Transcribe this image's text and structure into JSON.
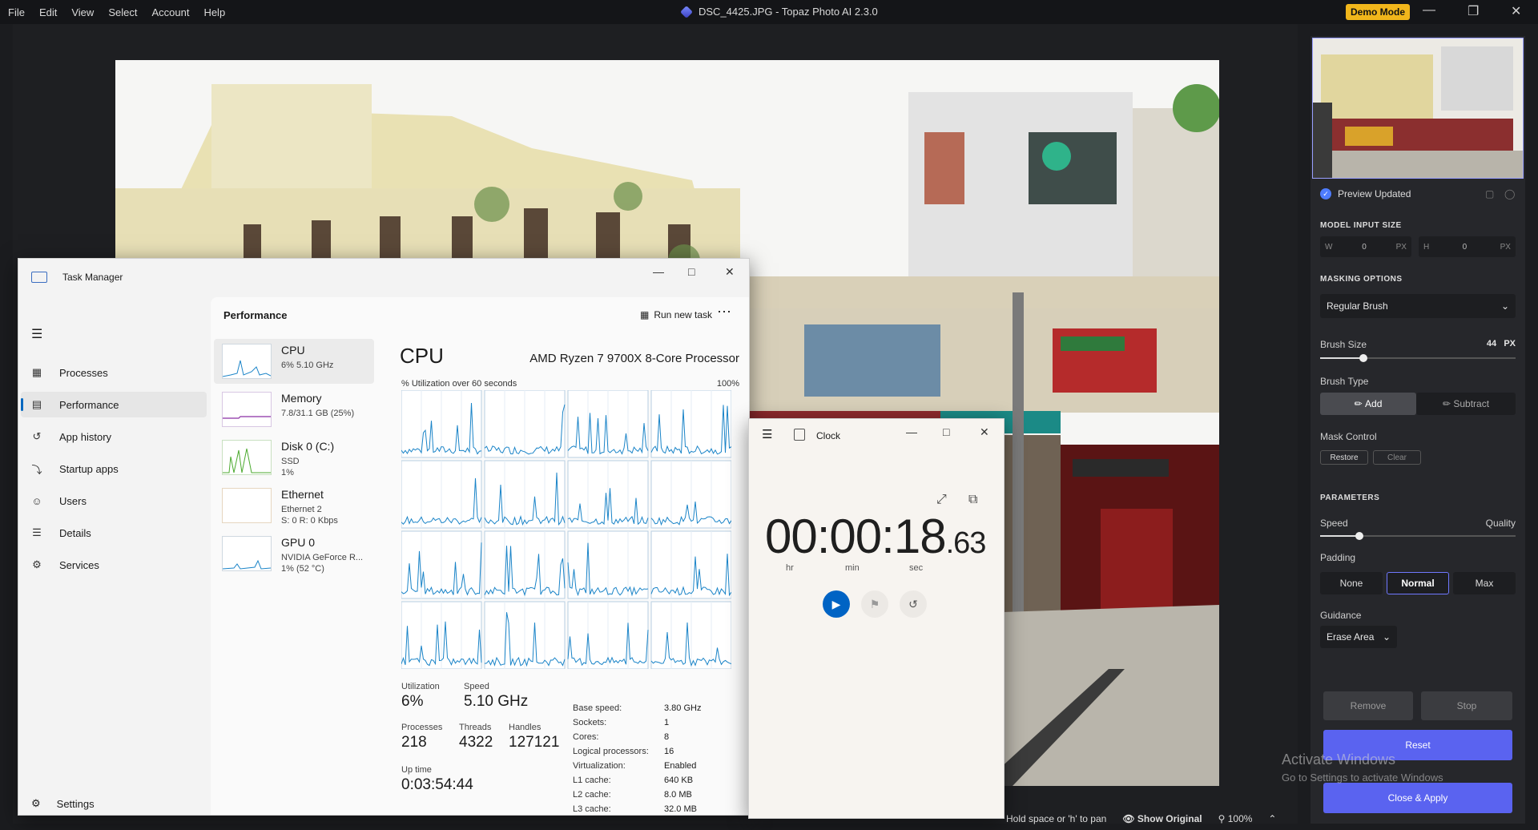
{
  "topaz": {
    "menu": [
      "File",
      "Edit",
      "View",
      "Select",
      "Account",
      "Help"
    ],
    "title": "DSC_4425.JPG - Topaz Photo AI 2.3.0",
    "demo_mode": "Demo Mode",
    "bottom": {
      "hint": "Hold space or 'h' to pan",
      "show_original": "Show Original",
      "zoom": "100%"
    },
    "panel": {
      "preview_status": "Preview Updated",
      "model_input_size": "MODEL INPUT SIZE",
      "w_label": "W",
      "w_value": "0",
      "h_label": "H",
      "h_value": "0",
      "px": "PX",
      "masking_options": "MASKING OPTIONS",
      "brush_dropdown": "Regular Brush",
      "brush_size_label": "Brush Size",
      "brush_size_value": "44",
      "brush_size_unit": "PX",
      "brush_size_fraction": 0.22,
      "brush_type_label": "Brush Type",
      "add": "Add",
      "subtract": "Subtract",
      "mask_control": "Mask Control",
      "restore": "Restore",
      "clear": "Clear",
      "parameters": "PARAMETERS",
      "speed": "Speed",
      "quality": "Quality",
      "speed_quality_fraction": 0.2,
      "padding": "Padding",
      "padding_options": [
        "None",
        "Normal",
        "Max"
      ],
      "guidance": "Guidance",
      "guidance_value": "Erase Area",
      "remove": "Remove",
      "stop": "Stop",
      "reset": "Reset",
      "close_apply": "Close & Apply"
    },
    "activate": {
      "line1": "Activate Windows",
      "line2": "Go to Settings to activate Windows"
    }
  },
  "task_manager": {
    "title": "Task Manager",
    "nav": [
      "Processes",
      "Performance",
      "App history",
      "Startup apps",
      "Users",
      "Details",
      "Services"
    ],
    "settings": "Settings",
    "header": "Performance",
    "run_new_task": "Run new task",
    "resources": [
      {
        "name": "CPU",
        "lines": [
          "6%  5.10 GHz"
        ]
      },
      {
        "name": "Memory",
        "lines": [
          "7.8/31.1 GB (25%)"
        ]
      },
      {
        "name": "Disk 0 (C:)",
        "lines": [
          "SSD",
          "1%"
        ]
      },
      {
        "name": "Ethernet",
        "lines": [
          "Ethernet 2",
          "S: 0 R: 0 Kbps"
        ]
      },
      {
        "name": "GPU 0",
        "lines": [
          "NVIDIA GeForce R...",
          "1% (52 °C)"
        ]
      }
    ],
    "cpu_title": "CPU",
    "cpu_name": "AMD Ryzen 7 9700X 8-Core Processor",
    "util_label": "% Utilization over 60 seconds",
    "util_max": "100%",
    "stats": {
      "utilization_label": "Utilization",
      "utilization": "6%",
      "speed_label": "Speed",
      "speed": "5.10 GHz",
      "processes_label": "Processes",
      "processes": "218",
      "threads_label": "Threads",
      "threads": "4322",
      "handles_label": "Handles",
      "handles": "127121",
      "uptime_label": "Up time",
      "uptime": "0:03:54:44"
    },
    "details": [
      [
        "Base speed:",
        "3.80 GHz"
      ],
      [
        "Sockets:",
        "1"
      ],
      [
        "Cores:",
        "8"
      ],
      [
        "Logical processors:",
        "16"
      ],
      [
        "Virtualization:",
        "Enabled"
      ],
      [
        "L1 cache:",
        "640 KB"
      ],
      [
        "L2 cache:",
        "8.0 MB"
      ],
      [
        "L3 cache:",
        "32.0 MB"
      ]
    ]
  },
  "clock": {
    "title": "Clock",
    "hours": "00",
    "minutes": "00",
    "seconds": "18",
    "centiseconds": ".63",
    "unit_hr": "hr",
    "unit_min": "min",
    "unit_sec": "sec"
  }
}
